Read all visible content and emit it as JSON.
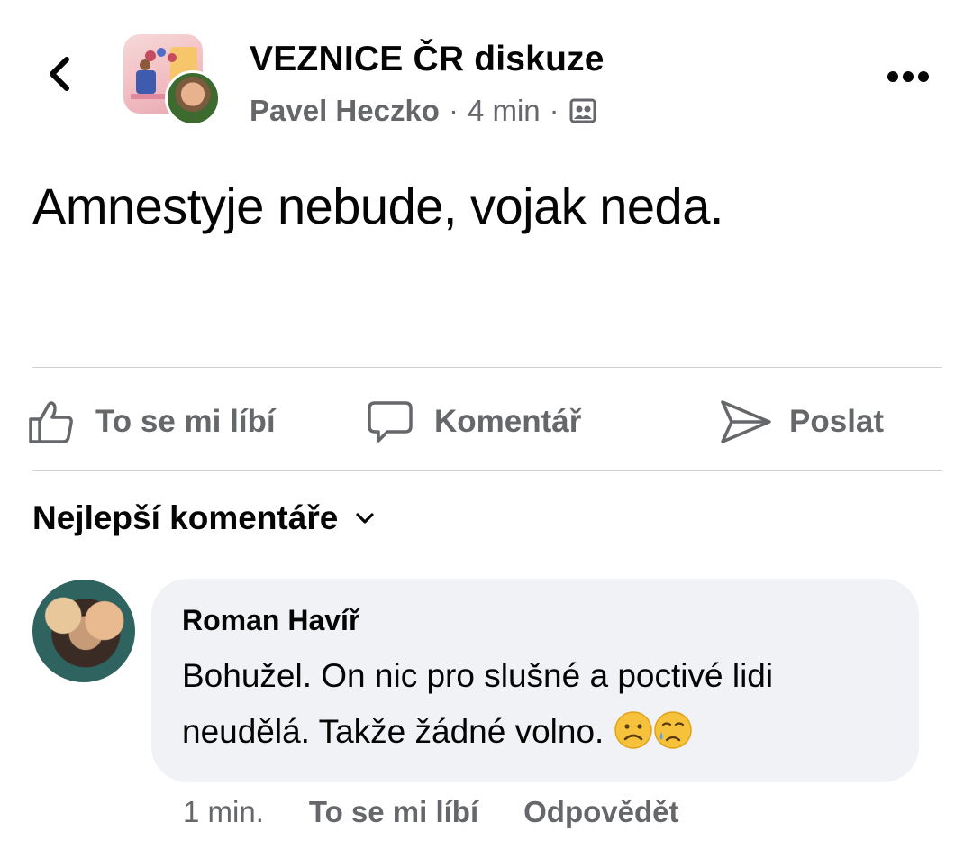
{
  "header": {
    "group_name": "VEZNICE ČR diskuze",
    "author": "Pavel Heczko",
    "separator": "·",
    "time": "4 min",
    "audience_icon": "group-members-icon"
  },
  "post": {
    "text": "Amnestyje nebude, vojak neda."
  },
  "actions": {
    "like_label": "To se mi líbí",
    "comment_label": "Komentář",
    "send_label": "Poslat"
  },
  "comments_section": {
    "sort_label": "Nejlepší komentáře"
  },
  "comment": {
    "author": "Roman Havíř",
    "text": "Bohužel. On nic pro slušné a poctivé lidi neudělá. Takže žádné volno.",
    "emojis": [
      "frowning-face-emoji",
      "sad-relieved-face-emoji"
    ],
    "time": "1 min.",
    "like_label": "To se mi líbí",
    "reply_label": "Odpovědět"
  },
  "colors": {
    "text_primary": "#050505",
    "text_secondary": "#65676b",
    "bubble_bg": "#f0f2f5",
    "divider": "#ced0d4"
  }
}
